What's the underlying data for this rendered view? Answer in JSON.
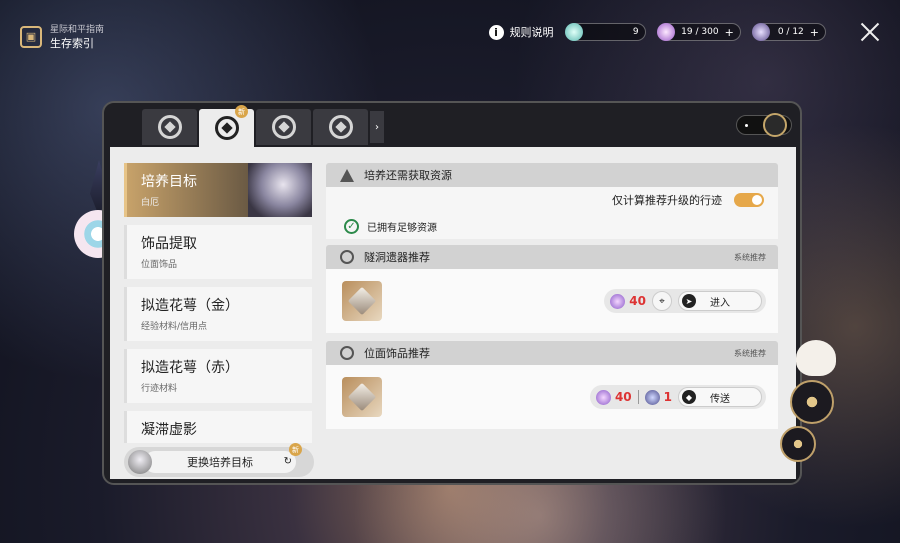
{
  "header": {
    "brand_sub": "星际和平指南",
    "brand_title": "生存索引",
    "rules_label": "规则说明",
    "resources": [
      {
        "name": "star-rail-pass-icon",
        "value": "9",
        "plus": false
      },
      {
        "name": "trailblaze-power-icon",
        "value": "19 / 300",
        "plus": true
      },
      {
        "name": "reserve-power-icon",
        "value": "0 / 12",
        "plus": true
      }
    ]
  },
  "tabs": {
    "new_badge": "新",
    "items": [
      "tab-1",
      "tab-2",
      "tab-3",
      "tab-4"
    ],
    "more": "›"
  },
  "left": {
    "cards": [
      {
        "title": "培养目标",
        "sub": "白厄"
      },
      {
        "title": "饰品提取",
        "sub": "位面饰品"
      },
      {
        "title": "拟造花萼（金）",
        "sub": "经验材料/信用点"
      },
      {
        "title": "拟造花萼（赤）",
        "sub": "行迹材料"
      },
      {
        "title": "凝滞虚影",
        "sub": ""
      }
    ],
    "swap_button": "更换培养目标",
    "swap_badge": "新"
  },
  "resources_needed": {
    "title": "培养还需获取资源",
    "toggle_label": "仅计算推荐升级的行迹",
    "toggle_on": true,
    "status": "已拥有足够资源"
  },
  "relic_section": {
    "title": "隧洞遗器推荐",
    "tag": "系统推荐",
    "cost": "40",
    "button": "进入"
  },
  "ornament_section": {
    "title": "位面饰品推荐",
    "tag": "系统推荐",
    "cost": "40",
    "cost2": "1",
    "button": "传送"
  },
  "colors": {
    "accent": "#e6a84a",
    "cost_red": "#dd3333",
    "ok_green": "#2c8a4a"
  }
}
